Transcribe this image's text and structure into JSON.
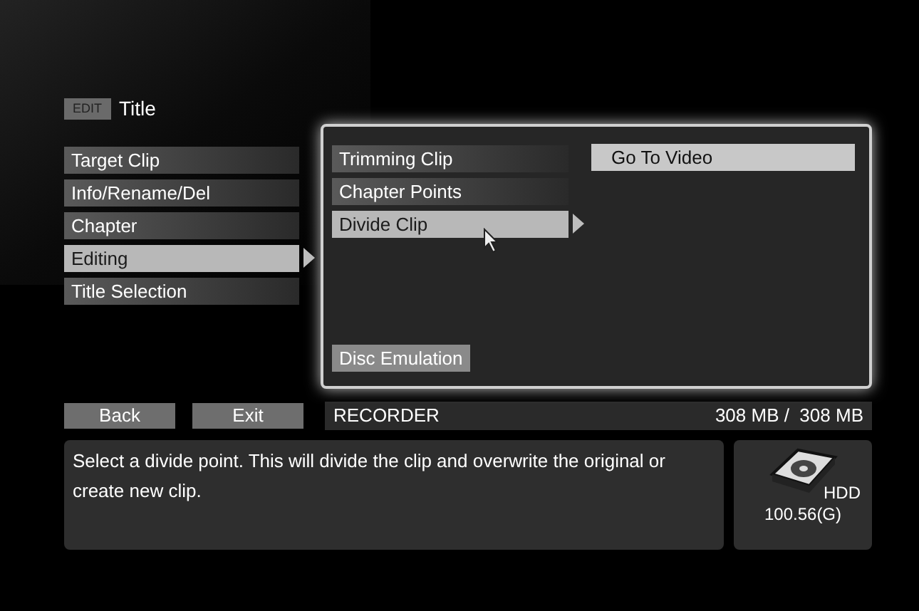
{
  "header": {
    "badge": "EDIT",
    "title": "Title"
  },
  "menu": [
    {
      "label": "Target Clip",
      "selected": false
    },
    {
      "label": "Info/Rename/Del",
      "selected": false
    },
    {
      "label": "Chapter",
      "selected": false
    },
    {
      "label": "Editing",
      "selected": true
    },
    {
      "label": "Title Selection",
      "selected": false
    }
  ],
  "submenu": [
    {
      "label": "Trimming Clip",
      "selected": false
    },
    {
      "label": "Chapter Points",
      "selected": false
    },
    {
      "label": "Divide Clip",
      "selected": true
    }
  ],
  "options": [
    {
      "label": "Go To Video",
      "selected": true
    }
  ],
  "disc_button": "Disc Emulation",
  "buttons": [
    "Back",
    "Exit"
  ],
  "status": {
    "source": "RECORDER",
    "capacity": "308 MB /  308 MB"
  },
  "message": "Select a divide point. This will divide the clip and overwrite the original or create new clip.",
  "drive": {
    "label": "HDD",
    "capacity": "100.56(G)"
  }
}
